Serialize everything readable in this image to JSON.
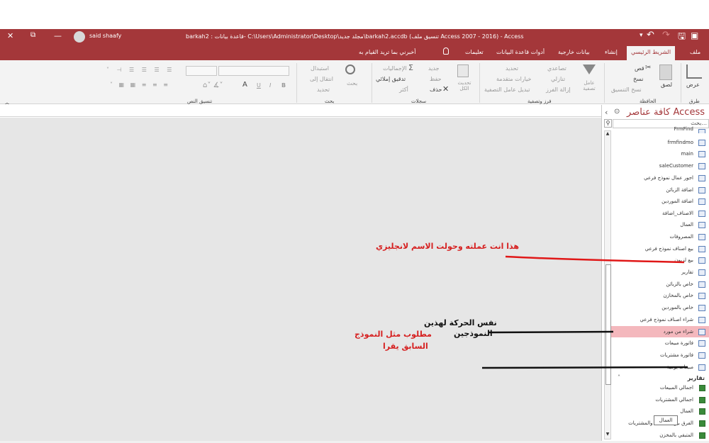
{
  "window": {
    "title": "barkah2 : قاعدة بيانات- C:\\Users\\Administrator\\Desktop\\مجلد جديد\\barkah2.accdb (تنسيق ملف Access 2007 - 2016) - Access",
    "user": "said shaafy",
    "close_glyph": "✕",
    "restore_glyph": "⧉",
    "minimize_glyph": "—",
    "ribbon_opts_glyph": "▣"
  },
  "qat": {
    "more": "▾",
    "undo": "↶",
    "redo": "↷",
    "save": "🖫"
  },
  "tabs": [
    "ملف",
    "الشريط الرئيسي",
    "إنشاء",
    "بيانات خارجية",
    "أدوات قاعدة البيانات",
    "تعليمات"
  ],
  "tell_me": "أخبرني بما تريد القيام به",
  "ribbon": {
    "views": {
      "label": "عرض",
      "group": "طرق عرض"
    },
    "clipboard": {
      "paste": "لصق",
      "cut": "قص",
      "copy": "نسخ",
      "format_painter": "نسخ التنسيق",
      "group": "الحافظة"
    },
    "sort_filter": {
      "filter": "عامل تصفية",
      "ascending": "تصاعدي",
      "descending": "تنازلي",
      "remove_sort": "إزالة الفرز",
      "selection": "تحديد",
      "advanced": "خيارات متقدمة",
      "toggle_filter": "تبديل عامل التصفية",
      "group": "فرز وتصفية"
    },
    "records": {
      "refresh_all": "تحديث الكل",
      "new": "جديد",
      "save": "حفظ",
      "delete": "حذف",
      "totals": "الإجماليات",
      "spelling": "تدقيق إملائي",
      "more": "أكثر",
      "group": "سجلات"
    },
    "find": {
      "find": "بحث",
      "replace": "استبدال",
      "goto": "انتقال إلى",
      "select": "تحديد",
      "group": "بحث"
    },
    "text_format": {
      "bold": "B",
      "italic": "I",
      "underline": "U",
      "font_a": "A",
      "group": "تنسيق النص"
    }
  },
  "nav": {
    "title": "كافة عناصر Access",
    "search_placeholder": "بحث...",
    "items": [
      {
        "label": "FrmFind",
        "type": "form"
      },
      {
        "label": "frmfindmo",
        "type": "form"
      },
      {
        "label": "main",
        "type": "form"
      },
      {
        "label": "saleCustomer",
        "type": "form"
      },
      {
        "label": "اجور عمال نموذج فرعي",
        "type": "form"
      },
      {
        "label": "اضافة الزبائن",
        "type": "form"
      },
      {
        "label": "اضافة الموردين",
        "type": "form"
      },
      {
        "label": "الاصناف_اضافة",
        "type": "form"
      },
      {
        "label": "العمال",
        "type": "form"
      },
      {
        "label": "المصروفات",
        "type": "form"
      },
      {
        "label": "بيع اصناف نموذج فرعي",
        "type": "form"
      },
      {
        "label": "بيع لزبون",
        "type": "form"
      },
      {
        "label": "تقارير",
        "type": "form"
      },
      {
        "label": "خاص بالزبائن",
        "type": "form"
      },
      {
        "label": "خاص بالمخازن",
        "type": "form"
      },
      {
        "label": "خاص بالموردين",
        "type": "form"
      },
      {
        "label": "شراء اصناف نموذج فرعي",
        "type": "form"
      },
      {
        "label": "شراء من مورد",
        "type": "form",
        "selected": true
      },
      {
        "label": "فاتورة مبيعات",
        "type": "form"
      },
      {
        "label": "فاتورة مشتريات",
        "type": "form"
      },
      {
        "label": "مبيعات يومية",
        "type": "form"
      }
    ],
    "reports_section": "تقارير",
    "reports": [
      {
        "label": "اجمالي المبيعات"
      },
      {
        "label": "اجمالي المشتريات"
      },
      {
        "label": "العمال"
      },
      {
        "label": "الفرق بين المبيعات والمشتريات"
      },
      {
        "label": "المتبقي بالمخزن"
      }
    ],
    "tooltip": "العمال"
  },
  "annotations": {
    "red1": "هذا انت عملته وحولت الاسم لانجليزي",
    "black1_line1": "نفس الحركة لهذين",
    "black1_line2": "النموذجين",
    "red2_line1": "مطلوب مثل النموذج",
    "red2_line2": "السابق يقرا"
  },
  "colors": {
    "accent": "#a4373a",
    "selected_row": "#f4b8bd",
    "annotation_red": "#d62020",
    "annotation_line_red": "#e01818"
  }
}
